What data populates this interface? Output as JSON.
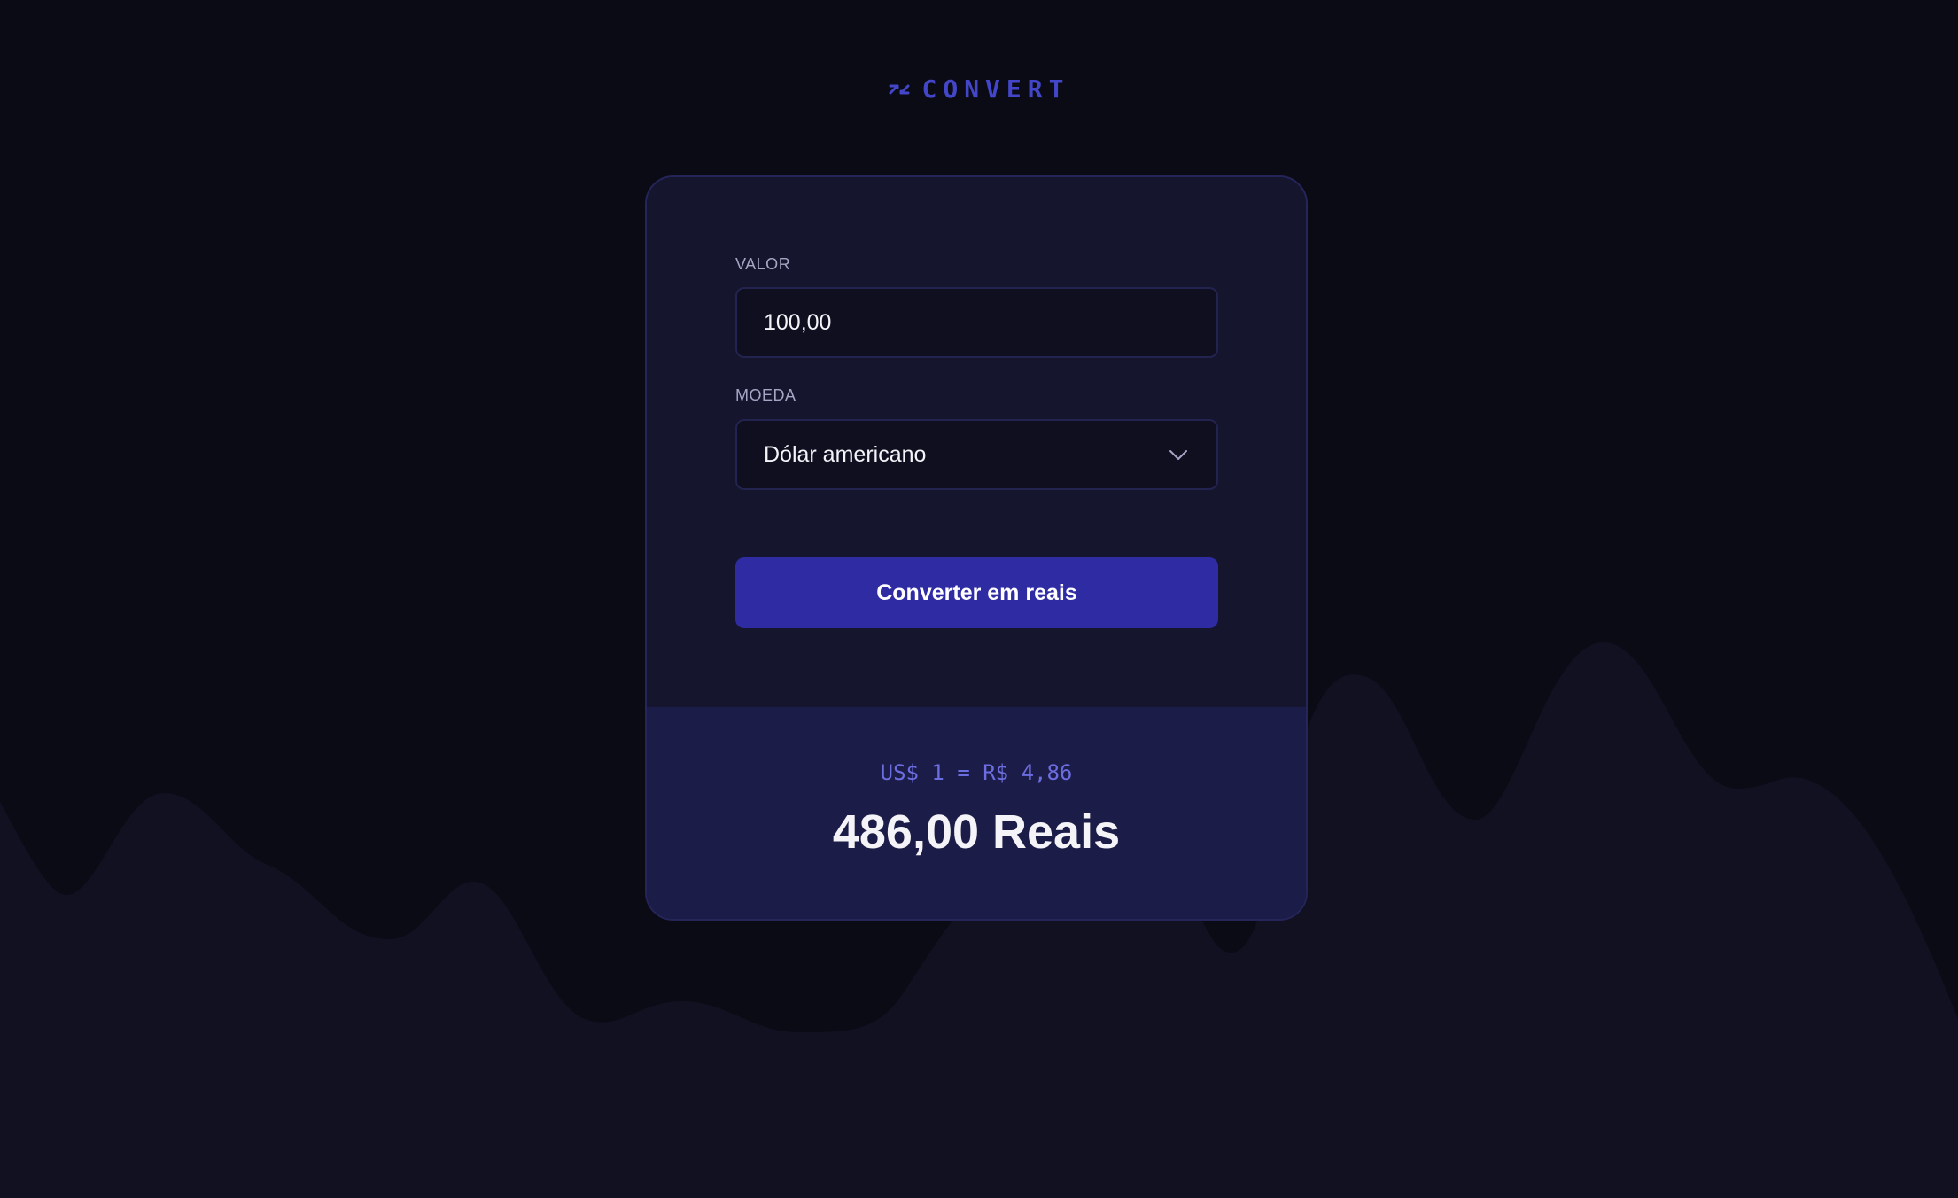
{
  "app": {
    "logo_text": "CONVERT",
    "logo_icon": "exchange-arrows-icon"
  },
  "form": {
    "amount_label": "VALOR",
    "amount_value": "100,00",
    "currency_label": "MOEDA",
    "currency_selected": "Dólar americano",
    "currency_dropdown_icon": "chevron-down-icon",
    "submit_label": "Converter em reais"
  },
  "result": {
    "rate_text": "US$ 1 = R$ 4,86",
    "total_text": "486,00 Reais"
  },
  "colors": {
    "background": "#0b0b16",
    "card": "#15152e",
    "card_result": "#1c1c48",
    "accent": "#2e2ba3",
    "brand": "#4346c9",
    "rate_text": "#6c6de0"
  }
}
